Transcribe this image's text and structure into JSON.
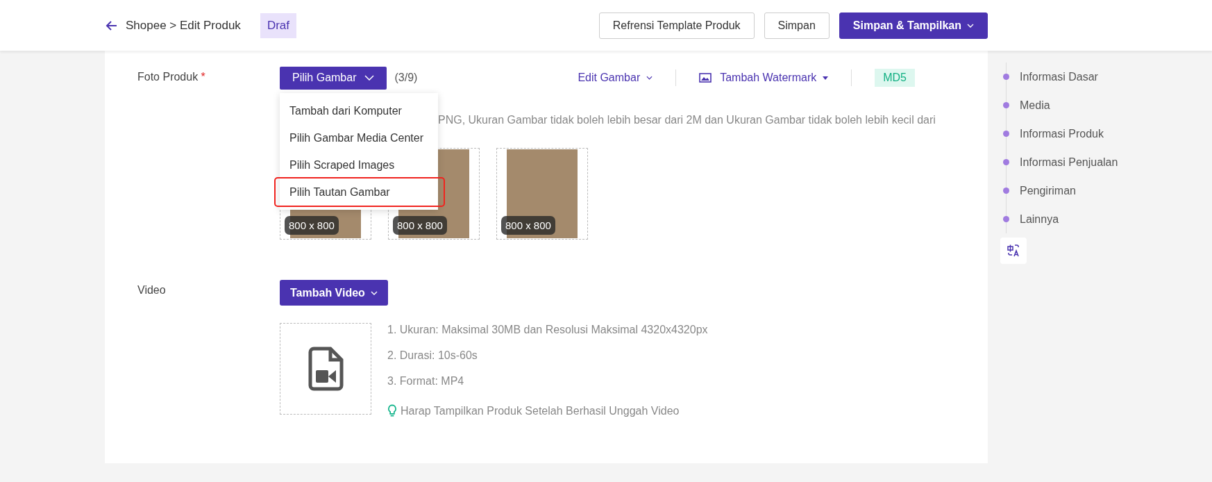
{
  "header": {
    "breadcrumb": "Shopee > Edit Produk",
    "status_badge": "Draf",
    "buttons": [
      {
        "label": "Refrensi Template Produk",
        "kind": "outline"
      },
      {
        "label": "Simpan",
        "kind": "outline"
      },
      {
        "label": "Simpan & Tampilkan",
        "kind": "primary"
      }
    ]
  },
  "photo_section": {
    "label": "Foto Produk",
    "required_mark": "*",
    "pick_button": "Pilih Gambar",
    "count": "(3/9)",
    "edit_link": "Edit Gambar",
    "watermark_link": "Tambah Watermark",
    "md5_badge": "MD5",
    "menu": [
      {
        "label": "Tambah dari Komputer",
        "highlighted": false
      },
      {
        "label": "Pilih Gambar Media Center",
        "highlighted": false
      },
      {
        "label": "Pilih Scraped Images",
        "highlighted": false
      },
      {
        "label": "Pilih Tautan Gambar",
        "highlighted": true
      }
    ],
    "hint": "PNG, Ukuran Gambar tidak boleh lebih besar dari 2M dan Ukuran Gambar tidak boleh lebih kecil dari",
    "photos": [
      {
        "size": "800 x 800"
      },
      {
        "size": "800 x 800"
      },
      {
        "size": "800 x 800"
      }
    ]
  },
  "video_section": {
    "label": "Video",
    "add_button": "Tambah Video",
    "rules": [
      "1. Ukuran: Maksimal 30MB dan Resolusi Maksimal 4320x4320px",
      "2. Durasi: 10s-60s",
      "3. Format: MP4"
    ],
    "tip": "Harap Tampilkan Produk Setelah Berhasil Unggah Video"
  },
  "side_nav": {
    "items": [
      "Informasi Dasar",
      "Media",
      "Informasi Produk",
      "Informasi Penjualan",
      "Pengiriman",
      "Lainnya"
    ]
  }
}
